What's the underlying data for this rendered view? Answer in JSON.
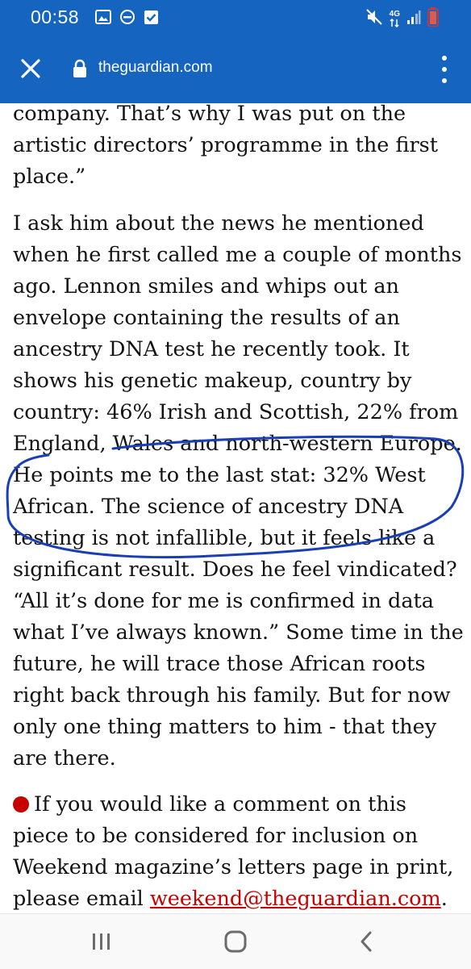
{
  "status_bar": {
    "time": "00:58",
    "network": "4G",
    "icons": [
      "image-icon",
      "do-not-disturb-icon",
      "check-box-icon",
      "mute-icon",
      "signal-icon",
      "battery-icon"
    ]
  },
  "toolbar": {
    "url": "theguardian.com"
  },
  "article": {
    "p1": "company. That’s why I was put on the artistic directors’ programme in the first place.”",
    "p2": "I ask him about the news he mentioned when he first called me a couple of months ago. Lennon smiles and whips out an envelope containing the results of an ancestry DNA test he recently took. It shows his genetic makeup, country by country: 46% Irish and Scottish, 22% from England, Wales and north-western Europe. He points me to the last stat: 32% West African. The science of ancestry DNA testing is not infallible, but it feels like a significant result. Does he feel vindicated? “All it’s done for me is confirmed in data what I’ve always known.” Some time in the future, he will trace those African roots right back through his family. But for now only one thing matters to him - that they are there.",
    "p3_text": "If you would like a comment on this piece to be considered for inclusion on Weekend magazine’s letters page in print, please email ",
    "p3_link": "weekend@theguardian.com",
    "p3_end": "."
  },
  "colors": {
    "toolbar_blue": "#1564c0",
    "guardian_red": "#c70000",
    "annotation_ink": "#1a3fb5",
    "body_text": "#121212"
  },
  "navbar": {
    "icons": [
      "recent-apps-icon",
      "home-icon",
      "back-icon"
    ]
  }
}
